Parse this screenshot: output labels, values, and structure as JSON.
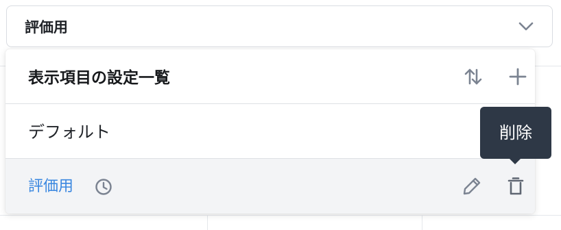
{
  "select": {
    "value": "評価用",
    "chevron_icon": "chevron-down-icon"
  },
  "panel": {
    "title": "表示項目の設定一覧",
    "sort_icon": "sort-arrows-icon",
    "add_icon": "plus-icon",
    "items": [
      {
        "label": "デフォルト"
      },
      {
        "label": "評価用",
        "selected": true,
        "status_icon": "clock-icon",
        "actions": [
          "pencil-icon",
          "trash-icon"
        ]
      }
    ]
  },
  "tooltip": {
    "text": "削除"
  },
  "colors": {
    "selected_text": "#3a87e0",
    "selected_row_bg": "#f3f4f6",
    "icon_gray": "#7b8391",
    "tooltip_bg": "#2e3846"
  }
}
